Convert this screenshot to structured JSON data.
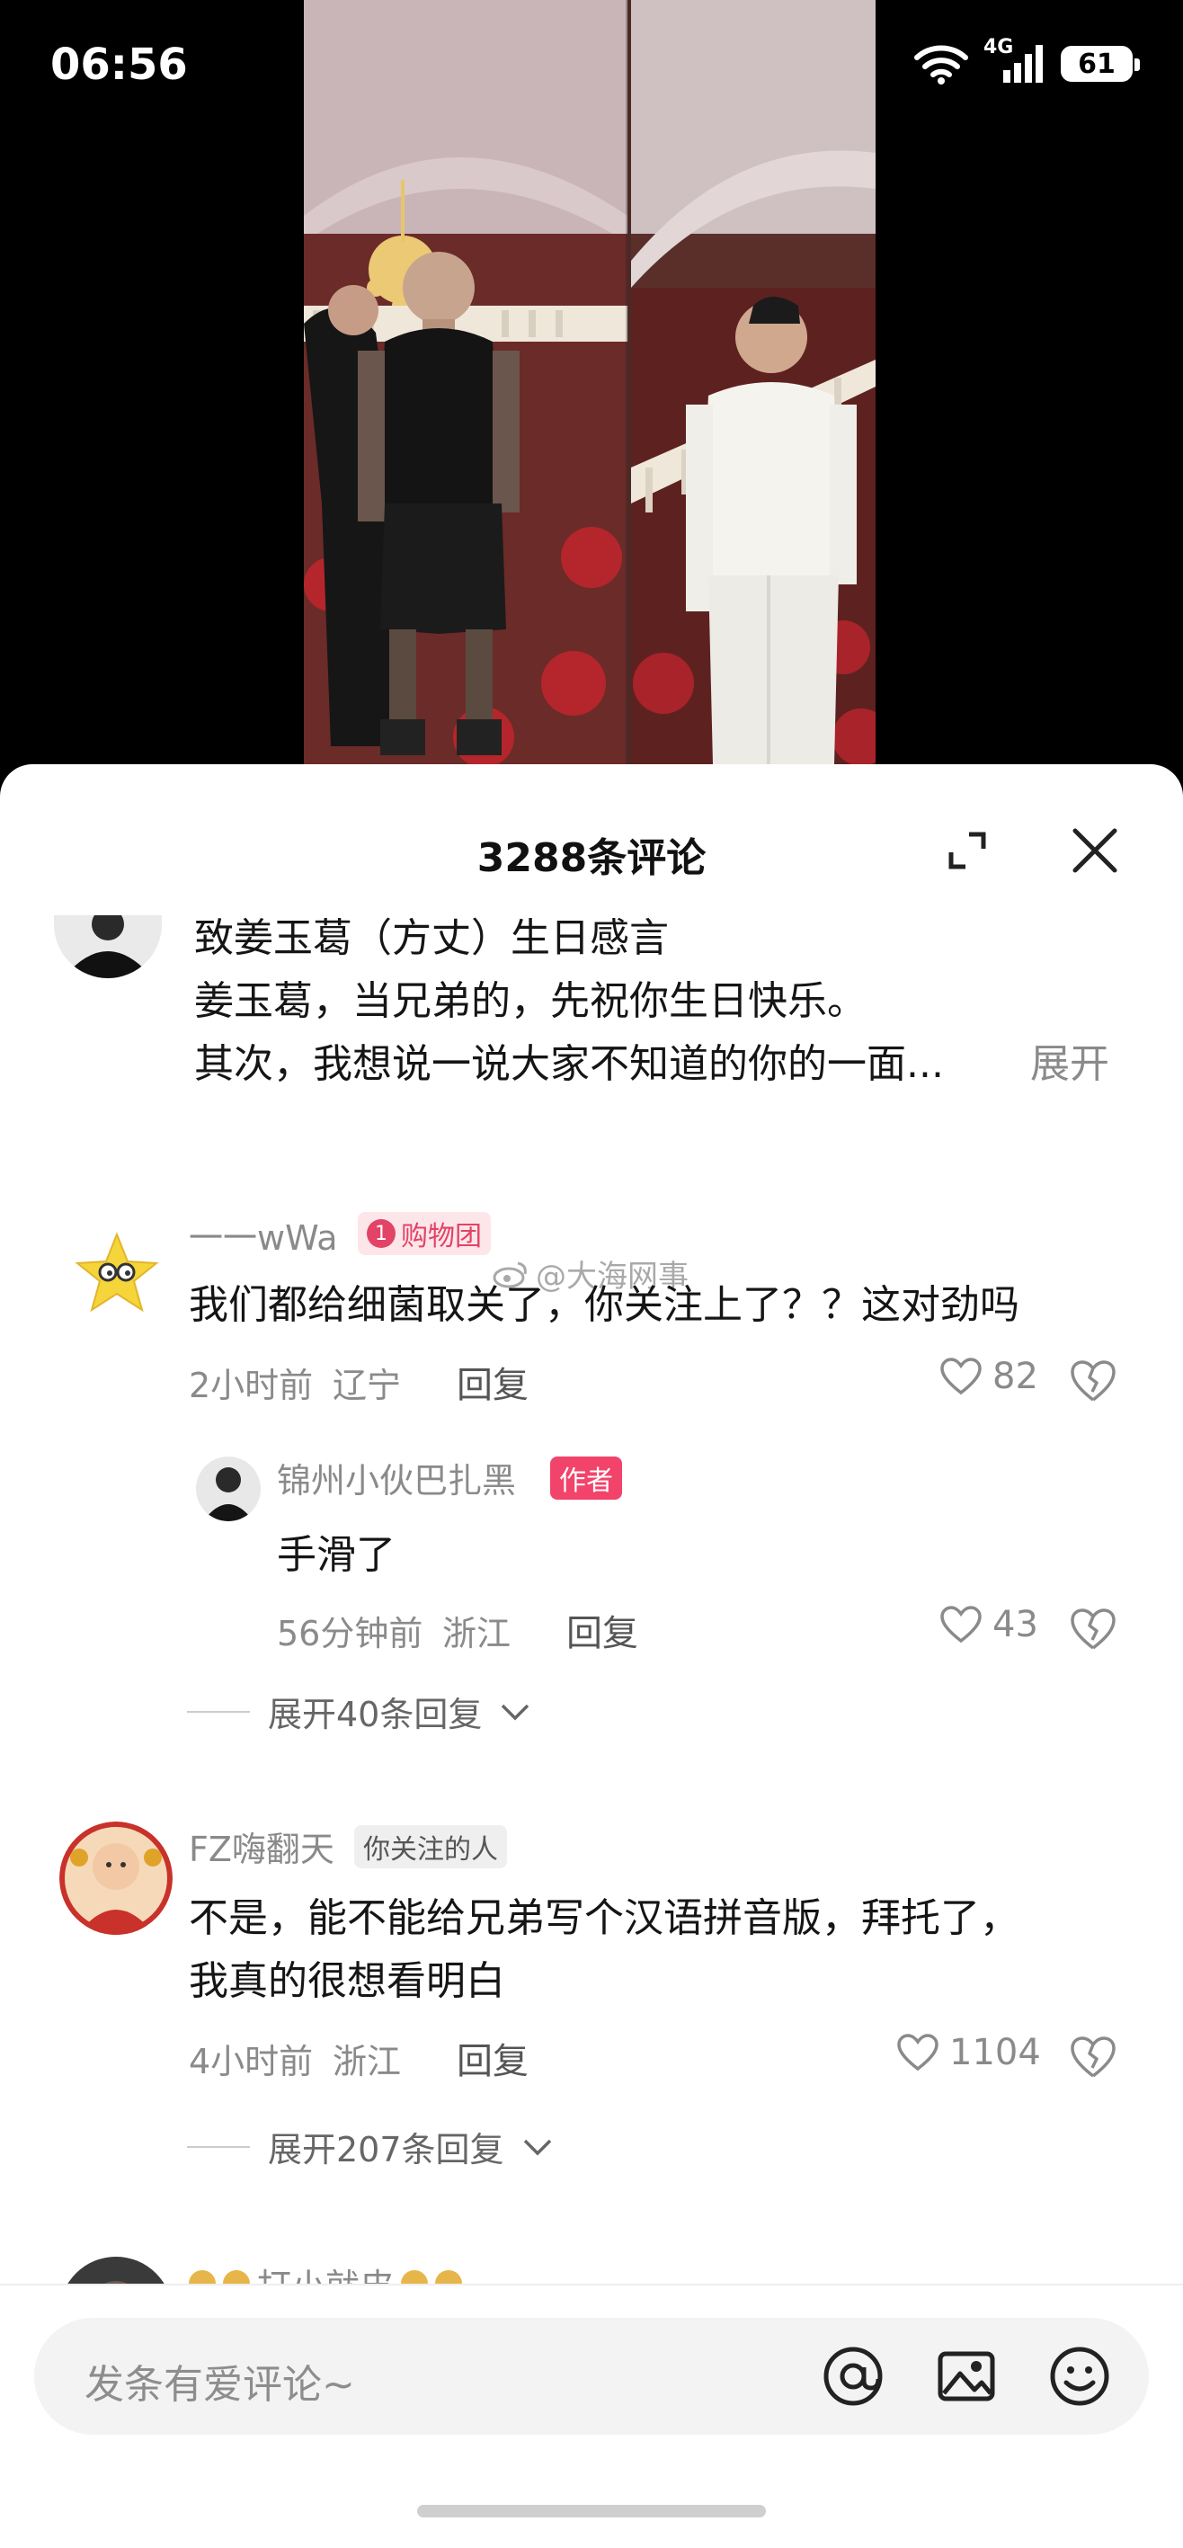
{
  "status_bar": {
    "time": "06:56",
    "network": "4G",
    "battery": "61"
  },
  "sheet": {
    "title": "3288条评论"
  },
  "comments": [
    {
      "lines": [
        "致姜玉葛（方丈）生日感言",
        "姜玉葛，当兄弟的，先祝你生日快乐。",
        "其次，我想说一说大家不知道的你的一面..."
      ],
      "expand": "展开"
    },
    {
      "username": "一一wWa",
      "badge": "购物团",
      "badge_num": "1",
      "text": "我们都给细菌取关了，你关注上了？？这对劲吗",
      "time": "2小时前",
      "location": "辽宁",
      "reply_label": "回复",
      "likes": "82",
      "replies": [
        {
          "username": "锦州小伙巴扎黑",
          "badge": "作者",
          "text": "手滑了",
          "time": "56分钟前",
          "location": "浙江",
          "reply_label": "回复",
          "likes": "43"
        }
      ],
      "expand_replies": "展开40条回复"
    },
    {
      "username": "FZ嗨翻天",
      "badge": "你关注的人",
      "lines": [
        "不是，能不能给兄弟写个汉语拼音版，拜托了，",
        "我真的很想看明白"
      ],
      "time": "4小时前",
      "location": "浙江",
      "reply_label": "回复",
      "likes": "1104",
      "expand_replies": "展开207条回复"
    },
    {
      "username": "打小就皮"
    }
  ],
  "watermark": "@大海网事",
  "input": {
    "placeholder": "发条有爱评论~"
  },
  "icons": [
    "wifi-icon",
    "signal-icon",
    "battery-icon",
    "expand-icon",
    "close-icon",
    "heart-icon",
    "broken-heart-icon",
    "chevron-down-icon",
    "at-icon",
    "image-icon",
    "emoji-icon"
  ],
  "colors": {
    "accent_pink": "#f2436a",
    "text_gray": "#8a8a8a",
    "background": "#ffffff"
  }
}
